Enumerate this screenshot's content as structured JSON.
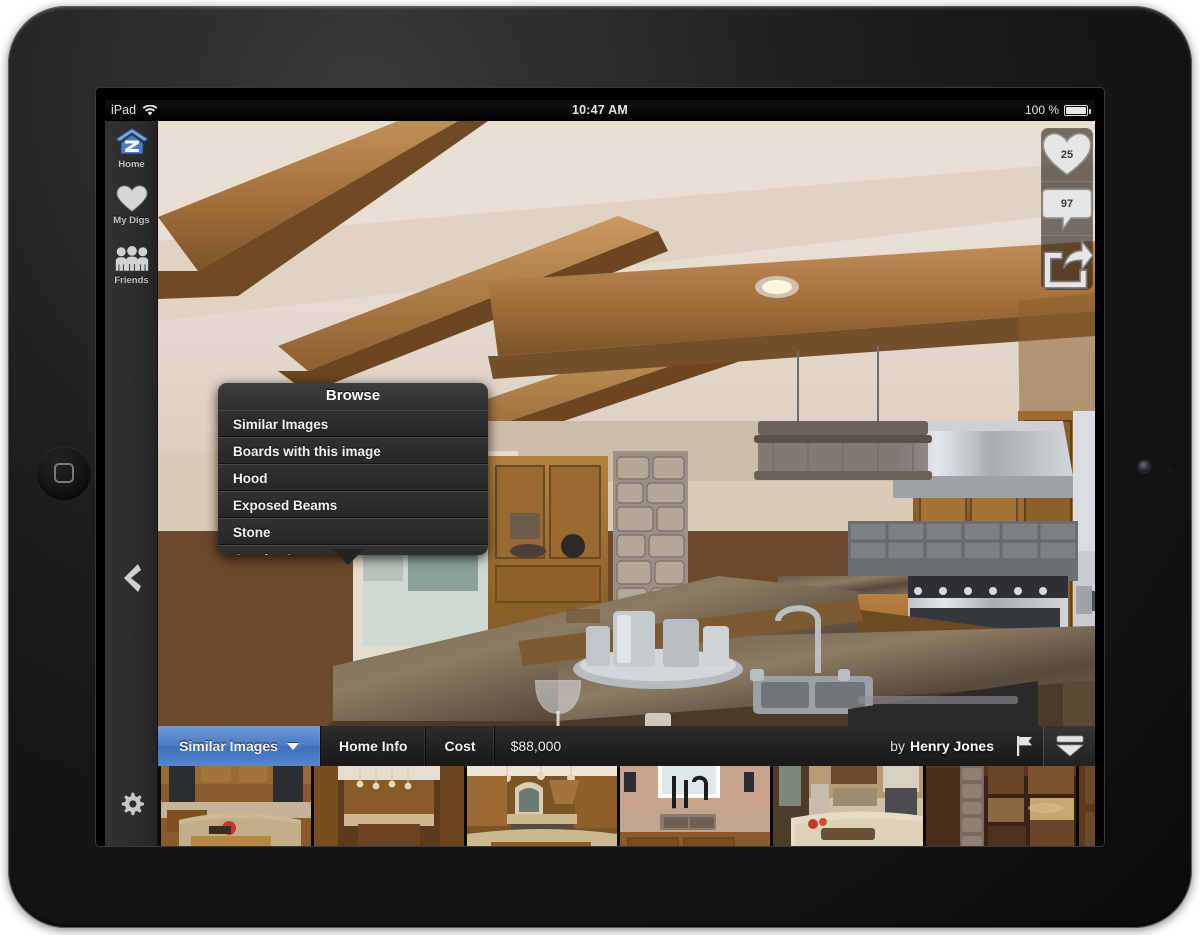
{
  "status_bar": {
    "device_label": "iPad",
    "wifi_icon": "wifi-icon",
    "time": "10:47 AM",
    "battery_text": "100 %",
    "battery_icon": "battery-full-icon"
  },
  "sidebar": {
    "items": [
      {
        "id": "home",
        "label": "Home",
        "icon": "zillow-home-logo-icon"
      },
      {
        "id": "my-digs",
        "label": "My Digs",
        "icon": "heart-icon"
      },
      {
        "id": "friends",
        "label": "Friends",
        "icon": "friends-group-icon"
      }
    ],
    "collapse_icon": "chevron-left-icon",
    "settings_icon": "gear-icon"
  },
  "action_rail": {
    "like": {
      "icon": "heart-icon",
      "count": "25"
    },
    "comment": {
      "icon": "speech-bubble-icon",
      "count": "97"
    },
    "share": {
      "icon": "share-arrow-icon"
    }
  },
  "popover": {
    "title": "Browse",
    "items": [
      "Similar Images",
      "Boards with this image",
      "Hood",
      "Exposed Beams",
      "Stone",
      "Granite Countertop"
    ]
  },
  "toolbar": {
    "active_tab": "Similar Images",
    "dropdown_icon": "chevron-down-icon",
    "tabs": [
      "Home Info",
      "Cost"
    ],
    "price": "$88,000",
    "author_prefix": "by",
    "author_name": "Henry Jones",
    "flag_icon": "flag-icon",
    "collapse_icon": "collapse-down-icon"
  },
  "filmstrip": {
    "thumbnails": [
      {
        "id": "thumb-1",
        "alt": "kitchen with curved granite island and dark windows"
      },
      {
        "id": "thumb-2",
        "alt": "galley kitchen with pendant lights and wood floor"
      },
      {
        "id": "thumb-3",
        "alt": "kitchen with arched window and wood hood"
      },
      {
        "id": "thumb-4",
        "alt": "kitchen sink with black faucet at window"
      },
      {
        "id": "thumb-5",
        "alt": "white kitchen with large marble island"
      },
      {
        "id": "thumb-6",
        "alt": "rustic kitchen with stone column and dark cabinets"
      },
      {
        "id": "thumb-7",
        "alt": "partial kitchen thumbnail"
      }
    ]
  },
  "main_photo": {
    "alt": "Rustic kitchen with exposed wood ceiling beams, stainless range hood, stone column and granite island"
  },
  "colors": {
    "accent_blue": "#4a7bc4",
    "toolbar_dark": "#1f1f1f",
    "sidebar_dark": "#2e2e30",
    "popover_dark": "#272727",
    "text_light": "#f2f2f2"
  }
}
